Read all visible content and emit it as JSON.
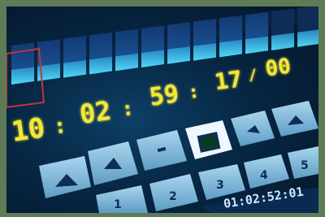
{
  "timecode": {
    "hours": "10",
    "minutes": "02",
    "seconds": "59",
    "frames": "17",
    "subframes": "00"
  },
  "secondary_timecode": "01:02:52:01",
  "keypad": {
    "digits": [
      "1",
      "2",
      "3",
      "4",
      "5"
    ]
  },
  "colors": {
    "frame": "#5f7a56",
    "timecode": "#f4e838",
    "key_face": "#7fb8d9",
    "meter_lit": "#3bd0ff",
    "background": "#072744"
  },
  "icons": [
    "rewind-icon",
    "play-icon",
    "stop-icon",
    "fast-forward-icon",
    "mark-icon"
  ]
}
